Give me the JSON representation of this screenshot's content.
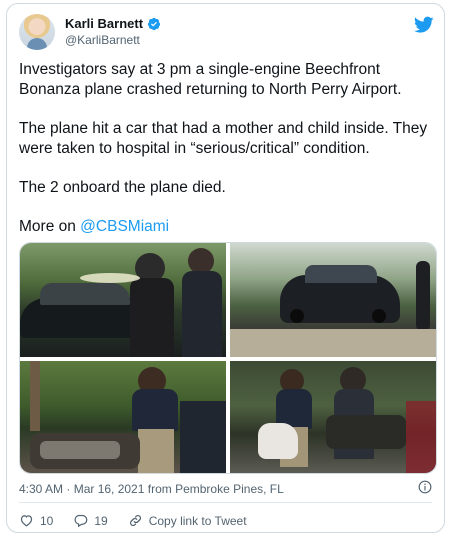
{
  "author": {
    "name": "Karli Barnett",
    "handle": "@KarliBarnett"
  },
  "tweet": {
    "paragraphs": [
      "Investigators say at 3 pm a single-engine Beechfront Bonanza plane crashed returning to North Perry Airport.",
      "The plane hit a car that had a mother and child inside. They were taken to hospital in “serious/critical” condition.",
      "The 2 onboard the plane died."
    ],
    "more_prefix": "More on ",
    "mention": "@CBSMiami"
  },
  "meta": {
    "timestamp": "4:30 AM · Mar 16, 2021 from Pembroke Pines, FL"
  },
  "actions": {
    "likes": "10",
    "replies": "19",
    "copy_link": "Copy link to Tweet"
  },
  "colors": {
    "accent": "#1d9bf0",
    "like": "#536471"
  },
  "icons": {
    "verified": "verified-badge-icon",
    "brand": "twitter-bird-icon",
    "info": "info-icon",
    "like": "heart-icon",
    "reply": "reply-bubble-icon",
    "share": "link-icon"
  }
}
